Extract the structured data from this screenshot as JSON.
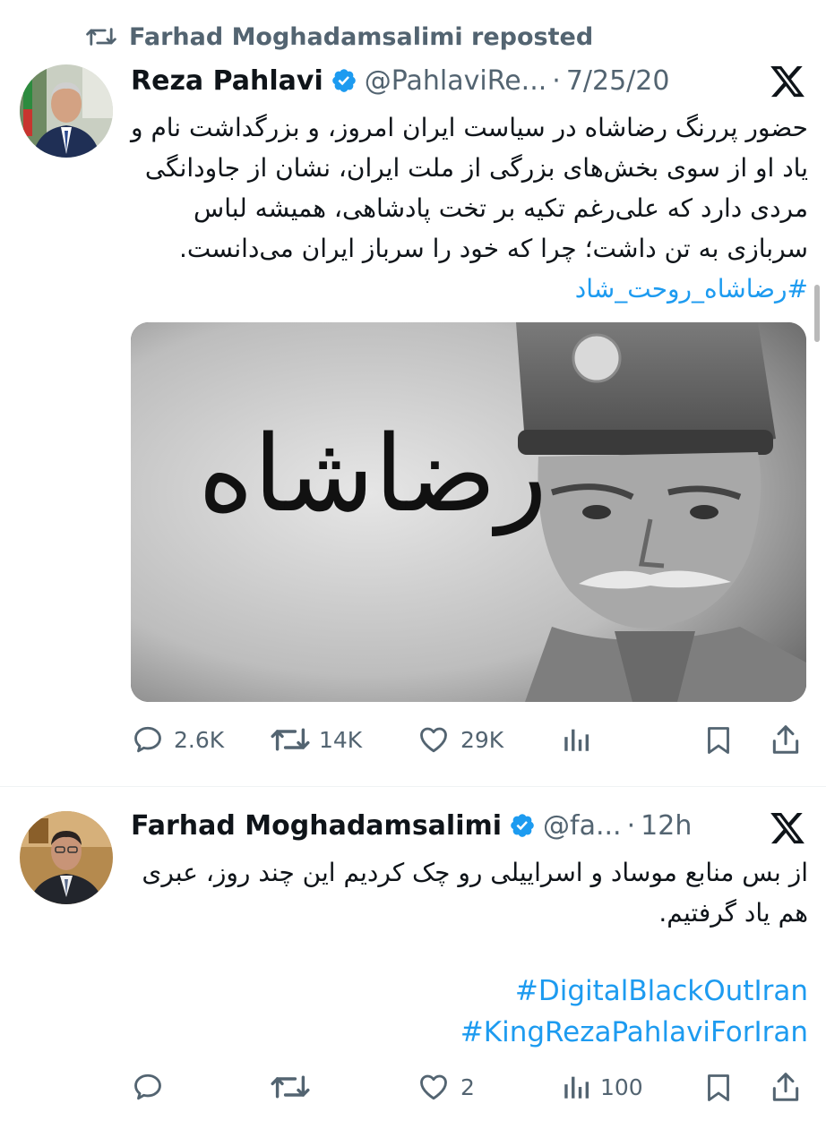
{
  "repost": {
    "label": "Farhad Moghadamsalimi reposted"
  },
  "tweets": [
    {
      "name": "Reza Pahlavi",
      "handle": "@PahlaviRe...",
      "dot": "·",
      "time": "7/25/20",
      "text": "حضور پررنگ رضاشاه در سیاست ایران امروز، و بزرگداشت نام و یاد او از سوی بخش‌های بزرگی از ملت ایران، نشان از جاودانگی مردی دارد که علی‌رغم تکیه بر تخت پادشاهی، همیشه لباس سربازی به تن داشت؛ چرا که خود را سرباز ایران می‌دانست. ",
      "hashtag": "#رضاشاه_روحت_شاد",
      "media": {
        "calligraphy": "رضاشاه"
      },
      "actions": {
        "replies": "2.6K",
        "reposts": "14K",
        "likes": "29K",
        "views": ""
      }
    },
    {
      "name": "Farhad Moghadamsalimi",
      "handle": "@fa...",
      "dot": "·",
      "time": "12h",
      "text": "از بس منابع موساد و اسراییلی رو چک کردیم این چند روز، عبری هم یاد گرفتیم.",
      "tags": [
        "#DigitalBlackOutIran",
        "#KingRezaPahlaviForIran"
      ],
      "actions": {
        "replies": "",
        "reposts": "",
        "likes": "2",
        "views": "100"
      }
    }
  ],
  "icons": {
    "repost": "repost-icon",
    "verified": "verified-badge-icon",
    "x": "x-logo-icon",
    "reply": "reply-icon",
    "like": "heart-icon",
    "views": "views-icon",
    "bookmark": "bookmark-icon",
    "share": "share-icon"
  },
  "colors": {
    "accent": "#1d9bf0",
    "muted": "#536471",
    "text": "#0f1419"
  }
}
